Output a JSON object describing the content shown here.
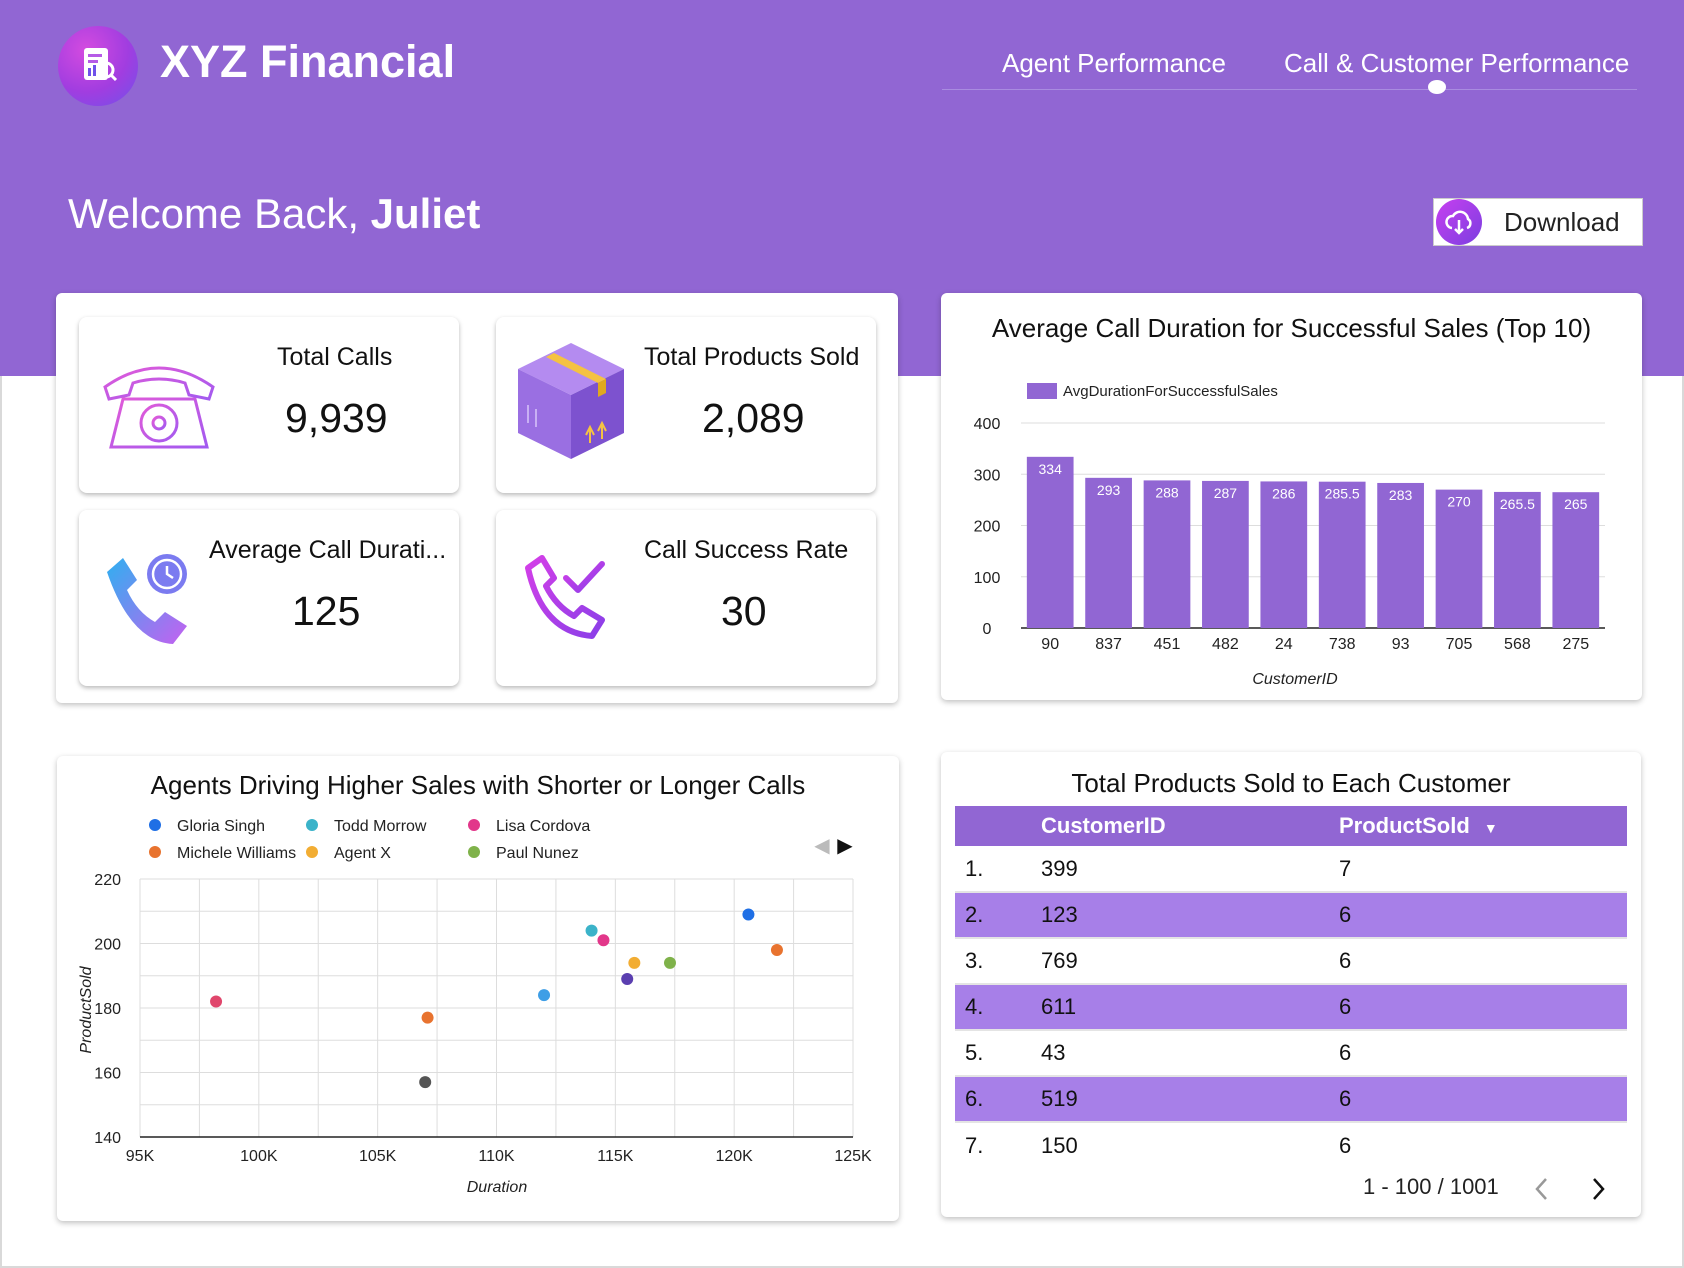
{
  "header": {
    "app_title": "XYZ Financial",
    "nav_tabs": [
      {
        "label": "Agent Performance"
      },
      {
        "label": "Call & Customer Performance"
      }
    ],
    "welcome_prefix": "Welcome Back, ",
    "welcome_name": "Juliet",
    "download_label": "Download"
  },
  "kpis": [
    {
      "title": "Total Calls",
      "value": "9,939",
      "icon": "telephone-icon"
    },
    {
      "title": "Total Products Sold",
      "value": "2,089",
      "icon": "box-icon"
    },
    {
      "title": "Average Call Durati...",
      "value": "125",
      "icon": "phone-clock-icon"
    },
    {
      "title": "Call Success Rate",
      "value": "30",
      "icon": "phone-check-icon"
    }
  ],
  "bar_chart": {
    "title": "Average Call Duration for Successful Sales (Top 10)",
    "legend": "AvgDurationForSuccessfulSales",
    "xlabel": "CustomerID",
    "yticks": [
      "0",
      "100",
      "200",
      "300",
      "400"
    ]
  },
  "scatter_chart": {
    "title": "Agents Driving Higher Sales with Shorter or Longer Calls",
    "xlabel": "Duration",
    "ylabel": "ProductSold",
    "xticks": [
      "95K",
      "100K",
      "105K",
      "110K",
      "115K",
      "120K",
      "125K"
    ],
    "yticks": [
      "140",
      "160",
      "180",
      "200",
      "220"
    ],
    "legend": [
      {
        "name": "Gloria Singh",
        "color": "#1f6fe5"
      },
      {
        "name": "Todd Morrow",
        "color": "#3bb3c9"
      },
      {
        "name": "Lisa Cordova",
        "color": "#e2378a"
      },
      {
        "name": "Michele Williams",
        "color": "#e8732f"
      },
      {
        "name": "Agent X",
        "color": "#f2ad33"
      },
      {
        "name": "Paul Nunez",
        "color": "#7fb24a"
      }
    ],
    "legend_prev": "◀",
    "legend_next": "▶"
  },
  "table": {
    "title": "Total Products Sold to Each Customer",
    "columns": [
      "CustomerID",
      "ProductSold"
    ],
    "sort_indicator": "▼",
    "rows": [
      {
        "idx": "1.",
        "customer": "399",
        "sold": "7"
      },
      {
        "idx": "2.",
        "customer": "123",
        "sold": "6"
      },
      {
        "idx": "3.",
        "customer": "769",
        "sold": "6"
      },
      {
        "idx": "4.",
        "customer": "611",
        "sold": "6"
      },
      {
        "idx": "5.",
        "customer": "43",
        "sold": "6"
      },
      {
        "idx": "6.",
        "customer": "519",
        "sold": "6"
      },
      {
        "idx": "7.",
        "customer": "150",
        "sold": "6"
      }
    ],
    "pagination": "1 - 100 / 1001",
    "prev_icon": "chevron-left-icon",
    "next_icon": "chevron-right-icon"
  },
  "colors": {
    "brand": "#9166d3",
    "bar": "#9166d3",
    "row_alt": "#a77fe8"
  },
  "chart_data": [
    {
      "type": "bar",
      "title": "Average Call Duration for Successful Sales (Top 10)",
      "xlabel": "CustomerID",
      "ylabel": "",
      "categories": [
        "90",
        "837",
        "451",
        "482",
        "24",
        "738",
        "93",
        "705",
        "568",
        "275"
      ],
      "series": [
        {
          "name": "AvgDurationForSuccessfulSales",
          "values": [
            334,
            293,
            288,
            287,
            286,
            285.5,
            283,
            270,
            265.5,
            265
          ]
        }
      ],
      "ylim": [
        0,
        400
      ],
      "legend": "top-left",
      "grid": true
    },
    {
      "type": "scatter",
      "title": "Agents Driving Higher Sales with Shorter or Longer Calls",
      "xlabel": "Duration",
      "ylabel": "ProductSold",
      "xlim": [
        95000,
        125000
      ],
      "ylim": [
        140,
        220
      ],
      "grid": true,
      "legend": "top-left",
      "points": [
        {
          "x": 98200,
          "y": 182,
          "color": "#e0466c"
        },
        {
          "x": 107100,
          "y": 177,
          "color": "#e8732f"
        },
        {
          "x": 107000,
          "y": 157,
          "color": "#555555"
        },
        {
          "x": 112000,
          "y": 184,
          "color": "#3e9ee6"
        },
        {
          "x": 114000,
          "y": 204,
          "color": "#3bb3c9"
        },
        {
          "x": 114500,
          "y": 201,
          "color": "#e2378a"
        },
        {
          "x": 115500,
          "y": 189,
          "color": "#5b3fb0"
        },
        {
          "x": 115800,
          "y": 194,
          "color": "#f2ad33"
        },
        {
          "x": 117300,
          "y": 194,
          "color": "#7fb24a"
        },
        {
          "x": 120600,
          "y": 209,
          "color": "#1f6fe5"
        },
        {
          "x": 121800,
          "y": 198,
          "color": "#e8732f"
        }
      ]
    }
  ]
}
